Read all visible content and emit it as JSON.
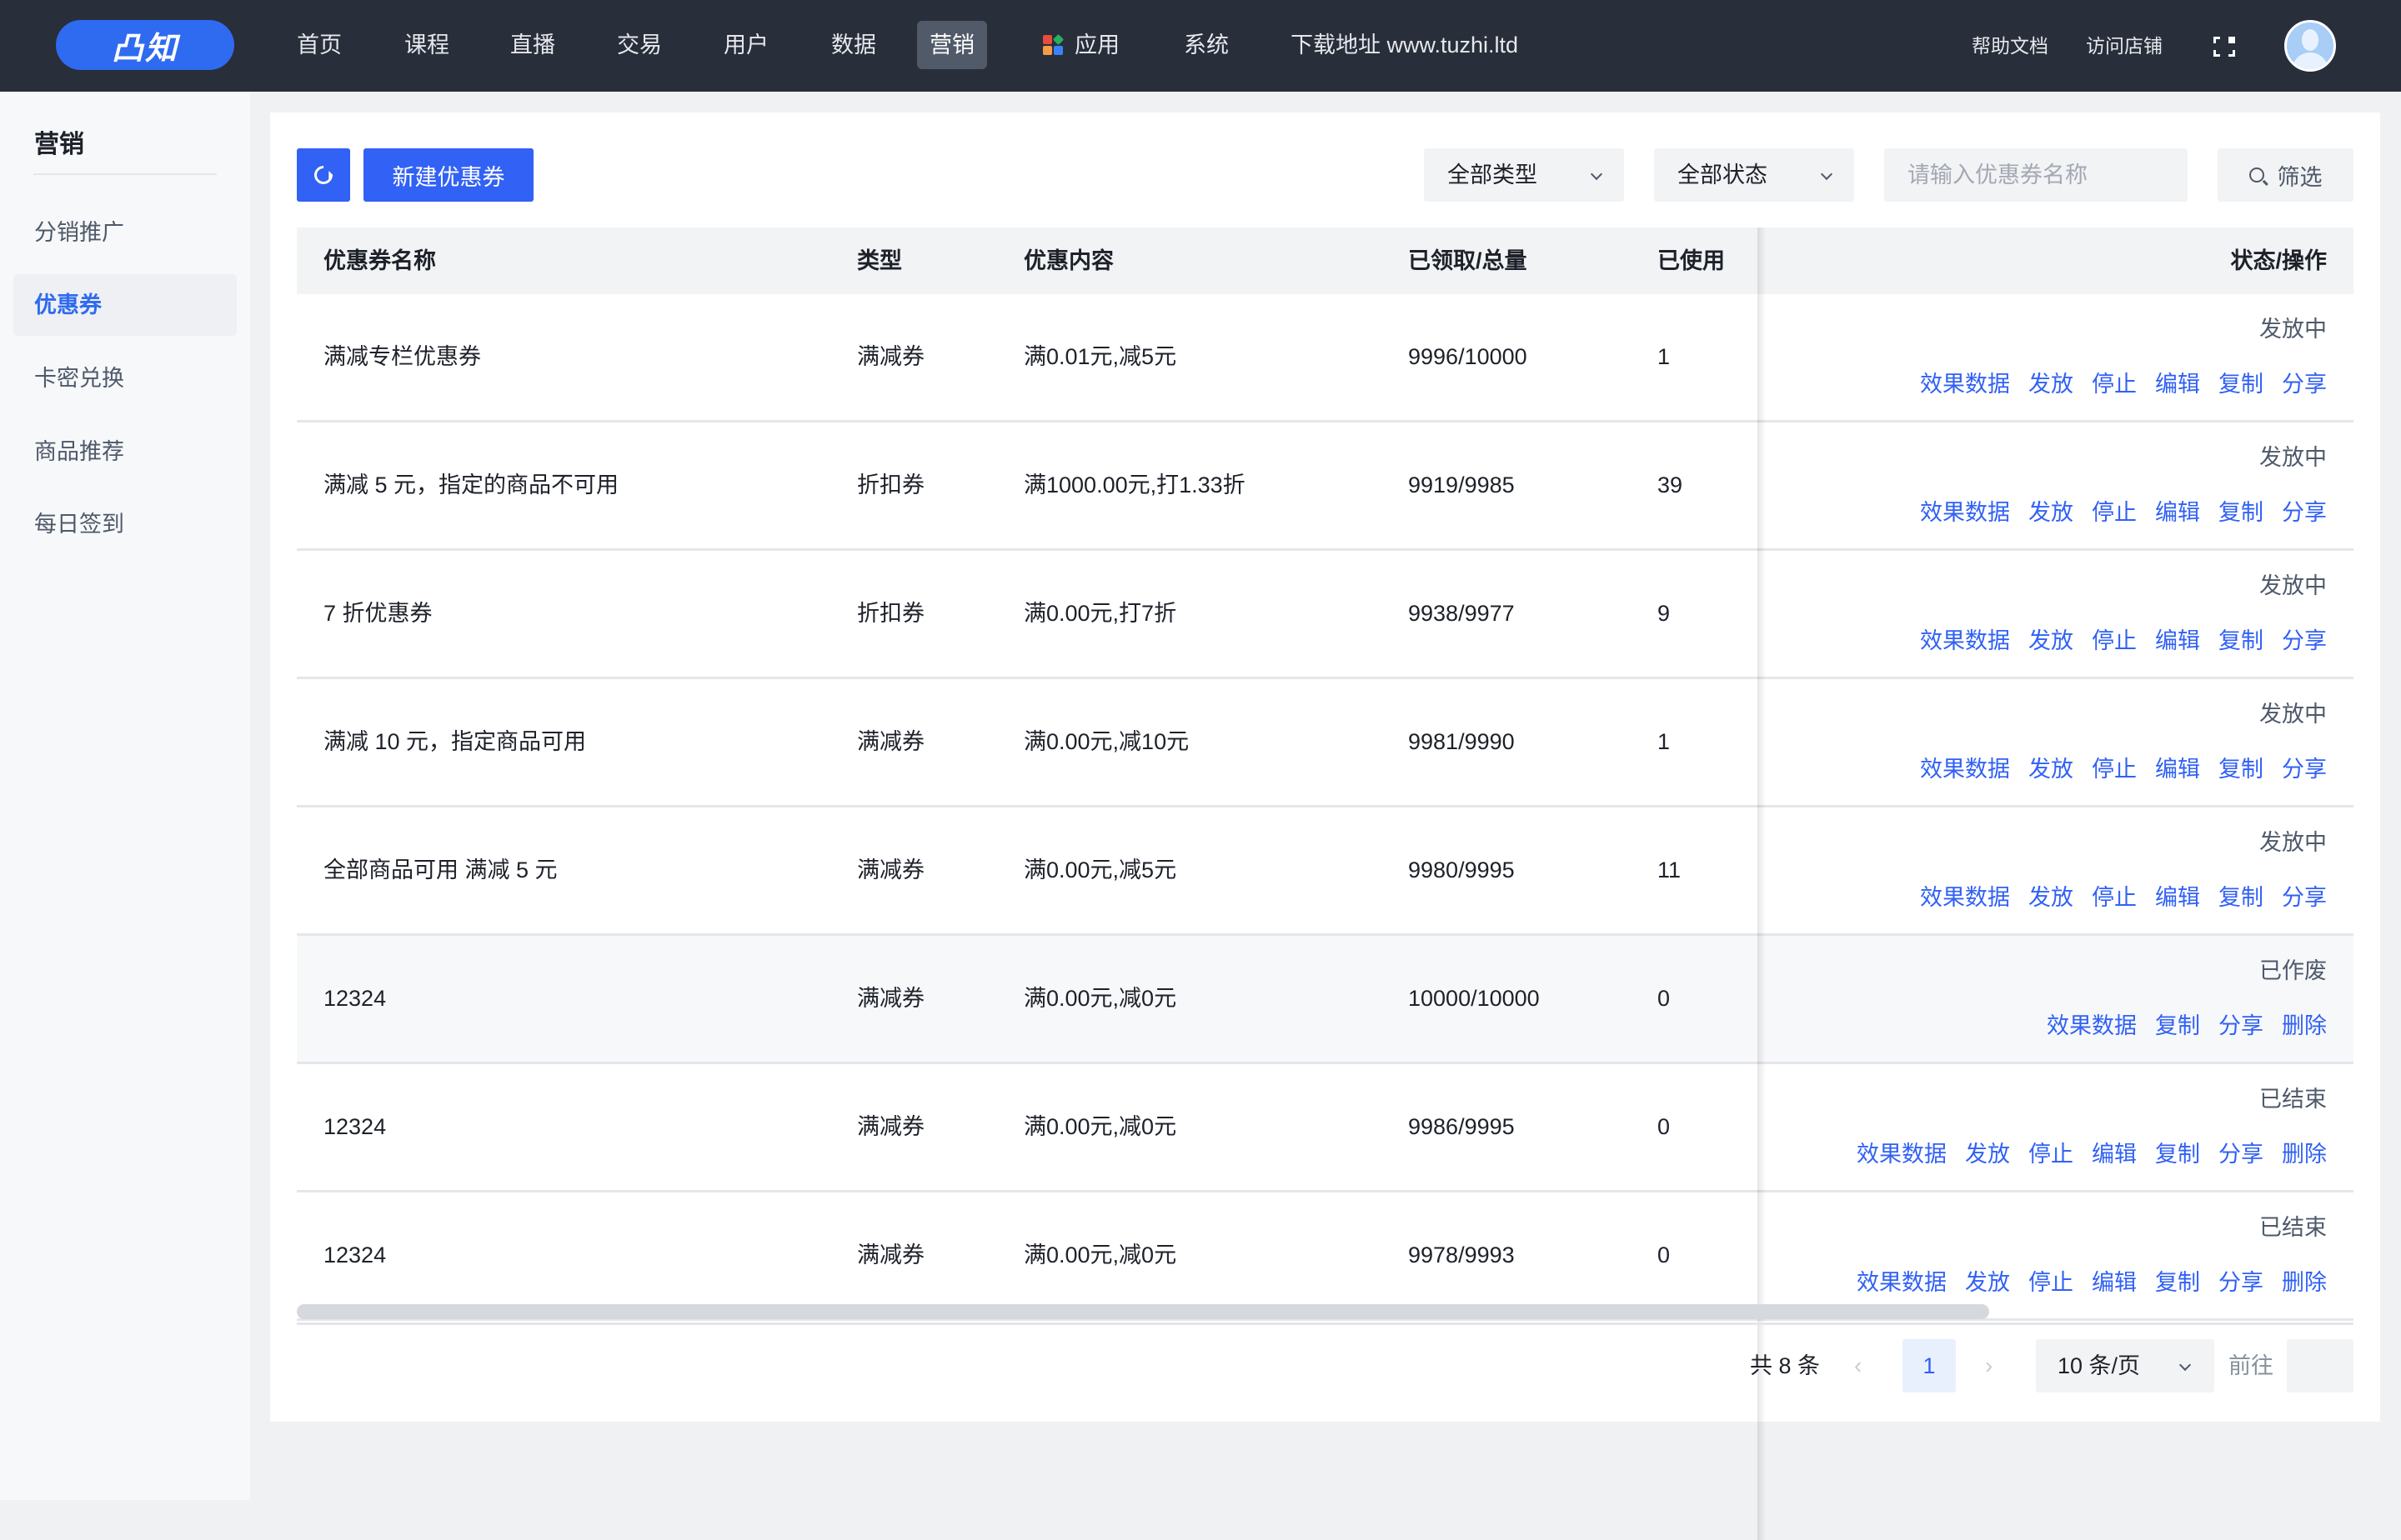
{
  "header": {
    "logo": "凸知",
    "nav": [
      {
        "label": "首页",
        "active": false
      },
      {
        "label": "课程",
        "active": false
      },
      {
        "label": "直播",
        "active": false
      },
      {
        "label": "交易",
        "active": false
      },
      {
        "label": "用户",
        "active": false
      },
      {
        "label": "数据",
        "active": false
      },
      {
        "label": "营销",
        "active": true
      },
      {
        "label": "应用",
        "active": false,
        "icon": "app-grid-icon"
      },
      {
        "label": "系统",
        "active": false
      },
      {
        "label": "下载地址 www.tuzhi.ltd",
        "active": false
      }
    ],
    "help_docs": "帮助文档",
    "visit_store": "访问店铺",
    "fullscreen_icon": "fullscreen-icon",
    "avatar_icon": "user-avatar-icon"
  },
  "sidebar": {
    "title": "营销",
    "items": [
      {
        "label": "分销推广",
        "active": false
      },
      {
        "label": "优惠券",
        "active": true
      },
      {
        "label": "卡密兑换",
        "active": false
      },
      {
        "label": "商品推荐",
        "active": false
      },
      {
        "label": "每日签到",
        "active": false
      }
    ]
  },
  "toolbar": {
    "refresh_icon": "refresh-icon",
    "new_coupon": "新建优惠券",
    "type_select": "全部类型",
    "status_select": "全部状态",
    "search_placeholder": "请输入优惠券名称",
    "search_value": "",
    "filter_label": "筛选"
  },
  "table": {
    "columns": [
      "优惠券名称",
      "类型",
      "优惠内容",
      "已领取/总量",
      "已使用",
      "状态/操作"
    ],
    "rows": [
      {
        "name": "满减专栏优惠券",
        "type": "满减券",
        "content": "满0.01元,减5元",
        "claimed": "9996/10000",
        "used": "1",
        "status": "发放中",
        "actions": [
          "效果数据",
          "发放",
          "停止",
          "编辑",
          "复制",
          "分享"
        ]
      },
      {
        "name": "满减 5 元，指定的商品不可用",
        "type": "折扣券",
        "content": "满1000.00元,打1.33折",
        "claimed": "9919/9985",
        "used": "39",
        "status": "发放中",
        "actions": [
          "效果数据",
          "发放",
          "停止",
          "编辑",
          "复制",
          "分享"
        ]
      },
      {
        "name": "7 折优惠券",
        "type": "折扣券",
        "content": "满0.00元,打7折",
        "claimed": "9938/9977",
        "used": "9",
        "status": "发放中",
        "actions": [
          "效果数据",
          "发放",
          "停止",
          "编辑",
          "复制",
          "分享"
        ]
      },
      {
        "name": "满减 10 元，指定商品可用",
        "type": "满减券",
        "content": "满0.00元,减10元",
        "claimed": "9981/9990",
        "used": "1",
        "status": "发放中",
        "actions": [
          "效果数据",
          "发放",
          "停止",
          "编辑",
          "复制",
          "分享"
        ]
      },
      {
        "name": "全部商品可用 满减 5 元",
        "type": "满减券",
        "content": "满0.00元,减5元",
        "claimed": "9980/9995",
        "used": "11",
        "status": "发放中",
        "actions": [
          "效果数据",
          "发放",
          "停止",
          "编辑",
          "复制",
          "分享"
        ]
      },
      {
        "name": "12324",
        "type": "满减券",
        "content": "满0.00元,减0元",
        "claimed": "10000/10000",
        "used": "0",
        "status": "已作废",
        "actions": [
          "效果数据",
          "复制",
          "分享",
          "删除"
        ]
      },
      {
        "name": "12324",
        "type": "满减券",
        "content": "满0.00元,减0元",
        "claimed": "9986/9995",
        "used": "0",
        "status": "已结束",
        "actions": [
          "效果数据",
          "发放",
          "停止",
          "编辑",
          "复制",
          "分享",
          "删除"
        ]
      },
      {
        "name": "12324",
        "type": "满减券",
        "content": "满0.00元,减0元",
        "claimed": "9978/9993",
        "used": "0",
        "status": "已结束",
        "actions": [
          "效果数据",
          "发放",
          "停止",
          "编辑",
          "复制",
          "分享",
          "删除"
        ]
      }
    ]
  },
  "pagination": {
    "total": "共 8 条",
    "prev": "‹",
    "current_page": "1",
    "next": "›",
    "page_size": "10 条/页",
    "goto_label": "前往",
    "goto_value": ""
  },
  "colors": {
    "header_bg": "#282e3a",
    "brand": "#2f6bf0",
    "primary": "#3161f5",
    "link": "#3161f5"
  }
}
